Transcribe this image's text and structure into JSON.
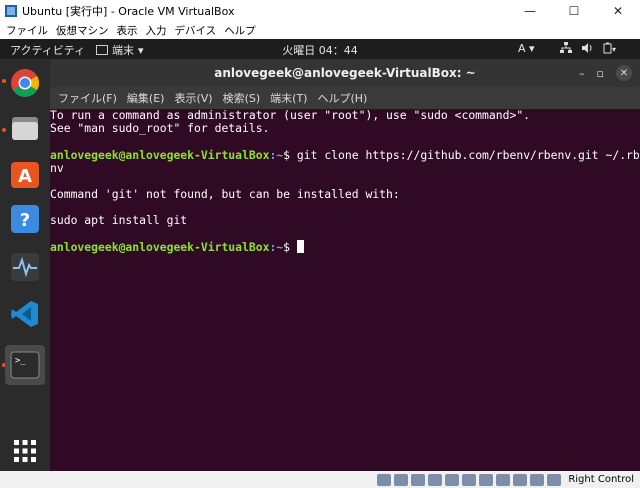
{
  "window": {
    "title": "Ubuntu [実行中] - Oracle VM VirtualBox",
    "minimize": "—",
    "maximize": "☐",
    "close": "✕"
  },
  "vbox_menu": [
    "ファイル",
    "仮想マシン",
    "表示",
    "入力",
    "デバイス",
    "ヘルプ"
  ],
  "topbar": {
    "activities": "アクティビティ",
    "app": "端末",
    "clock": "火曜日 04：44",
    "lang": "A"
  },
  "dock": {
    "items": [
      "chrome-icon",
      "files-icon",
      "software-center-icon",
      "help-icon",
      "system-monitor-icon",
      "vscode-icon",
      "terminal-icon",
      "show-apps-icon"
    ]
  },
  "terminal": {
    "title": "anlovegeek@anlovegeek-VirtualBox: ~",
    "menu": [
      "ファイル(F)",
      "編集(E)",
      "表示(V)",
      "検索(S)",
      "端末(T)",
      "ヘルプ(H)"
    ],
    "lines": {
      "l1": "To run a command as administrator (user \"root\"), use \"sudo <command>\".",
      "l2": "See \"man sudo_root\" for details.",
      "prompt_user": "anlovegeek@anlovegeek-VirtualBox",
      "prompt_path": ":~",
      "cmd1": "$ git clone https://github.com/rbenv/rbenv.git ~/.rbe",
      "cmd1_wrap": "nv",
      "l5": "Command 'git' not found, but can be installed with:",
      "l6": "sudo apt install git",
      "prompt2_tail": "$ "
    }
  },
  "status": {
    "right_control": "Right Control"
  }
}
